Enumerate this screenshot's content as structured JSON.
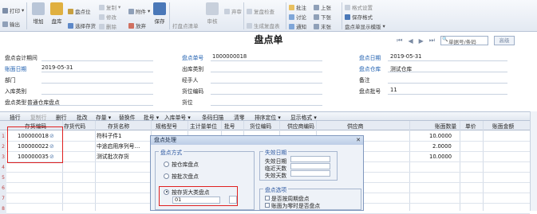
{
  "toolbar": {
    "print": "打印",
    "output": "输出",
    "add": "增加",
    "stocktake": "盘库",
    "stocktake_point": "盘点位",
    "select_inventory": "选择存货",
    "copy": "复制",
    "modify": "修改",
    "delete": "删除",
    "attachment": "附件",
    "discard": "放弃",
    "save": "保存",
    "print_stocktake_list": "打盘点清单",
    "audit": "审核",
    "abandon_audit": "弃审",
    "recheck": "复盘检查",
    "generate_recheck": "生成复盘表",
    "comment": "批注",
    "discuss": "讨论",
    "notify": "通知",
    "prev": "上张",
    "next": "下张",
    "last": "末张",
    "format_settings": "格式设置",
    "save_format": "保存格式",
    "template": "盘点单显示模版"
  },
  "page_title": "盘点单",
  "search": {
    "placeholder": "单据号/条码",
    "button": "高级"
  },
  "header": {
    "account_period_label": "盘点会计期间",
    "doc_no_label": "盘点单号",
    "doc_no": "1000000018",
    "date_label": "盘点日期",
    "date": "2019-05-31",
    "book_date_label": "账面日期",
    "book_date": "2019-05-31",
    "out_category_label": "出库类别",
    "warehouse_label": "盘点仓库",
    "warehouse": "测试仓库",
    "dept_label": "部门",
    "handler_label": "经手人",
    "remark_label": "备注",
    "in_category_label": "入库类别",
    "slot_code_label": "货位编码",
    "batch_label": "盘点批号",
    "batch": "11",
    "type_label": "盘点类型",
    "type": "普通仓库盘点",
    "slot_label": "货位"
  },
  "grid_toolbar": [
    "插行",
    "复制行",
    "删行",
    "批改",
    "存量 ▾",
    "替换件",
    "批号 ▾",
    "入库单号 ▾",
    "条码扫描",
    "清零",
    "排序定位 ▾",
    "显示格式 ▾"
  ],
  "grid_headers": [
    "存货编码",
    "存货代码",
    "存货名称",
    "规格型号",
    "主计量单位",
    "批号",
    "货位编码",
    "供应商编码",
    "供应商",
    "账面数量",
    "单价",
    "账面金额"
  ],
  "rows": [
    {
      "num": "1",
      "code": "100000018",
      "name": "符科子件1",
      "qty": "10.0000"
    },
    {
      "num": "2",
      "code": "100000022",
      "name": "中途启用序列号…",
      "qty": "2.0000"
    },
    {
      "num": "3",
      "code": "100000035",
      "name": "测试批次存货",
      "qty": "10.0000"
    },
    {
      "num": "4",
      "code": "",
      "name": "",
      "qty": ""
    },
    {
      "num": "5",
      "code": "",
      "name": "",
      "qty": ""
    },
    {
      "num": "6",
      "code": "",
      "name": "",
      "qty": ""
    },
    {
      "num": "7",
      "code": "",
      "name": "",
      "qty": ""
    },
    {
      "num": "8",
      "code": "",
      "name": "",
      "qty": ""
    }
  ],
  "dialog": {
    "title": "盘点处理",
    "method_group": "盘点方式",
    "by_warehouse": "按仓库盘点",
    "by_batch": "按批次盘点",
    "by_category": "按存货大类盘点",
    "category_value": "01",
    "expiry_group": "失效日期",
    "expiry_date": "失效日期",
    "near_days": "临近天数",
    "expired_days": "失效天数",
    "options_group": "盘点选项",
    "opt_1": "是否按周期盘点",
    "opt_2": "账面为零时是否盘点"
  }
}
